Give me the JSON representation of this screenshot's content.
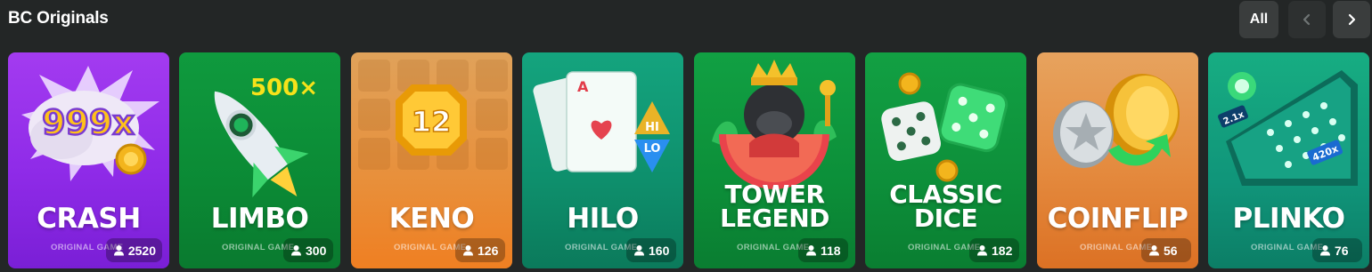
{
  "section": {
    "title": "BC Originals"
  },
  "nav": {
    "all_label": "All",
    "prev_icon": "chevron-left-icon",
    "next_icon": "chevron-right-icon"
  },
  "games": [
    {
      "name_lines": [
        "CRASH"
      ],
      "subtitle": "ORIGINAL GAME",
      "players": "2520",
      "art_text": "999x",
      "color": "#9b34ee"
    },
    {
      "name_lines": [
        "LIMBO"
      ],
      "subtitle": "ORIGINAL GAME",
      "players": "300",
      "art_text": "500×",
      "color": "#0d9139"
    },
    {
      "name_lines": [
        "KENO"
      ],
      "subtitle": "ORIGINAL GAME",
      "players": "126",
      "art_text": "12",
      "color": "#e8913c"
    },
    {
      "name_lines": [
        "HILO"
      ],
      "subtitle": "ORIGINAL GAME",
      "players": "160",
      "art_text": [
        "A",
        "HI",
        "LO"
      ],
      "color": "#11977a"
    },
    {
      "name_lines": [
        "TOWER",
        "LEGEND"
      ],
      "subtitle": "ORIGINAL GAME",
      "players": "118",
      "art_text": "",
      "color": "#0e963c"
    },
    {
      "name_lines": [
        "CLASSIC",
        "DICE"
      ],
      "subtitle": "ORIGINAL GAME",
      "players": "182",
      "art_text": "",
      "color": "#0f953c"
    },
    {
      "name_lines": [
        "COINFLIP"
      ],
      "subtitle": "ORIGINAL GAME",
      "players": "56",
      "art_text": "",
      "color": "#e4883c"
    },
    {
      "name_lines": [
        "PLINKO"
      ],
      "subtitle": "ORIGINAL GAME",
      "players": "76",
      "art_text": [
        "2.1x",
        "420x"
      ],
      "color": "#129a7c"
    }
  ]
}
